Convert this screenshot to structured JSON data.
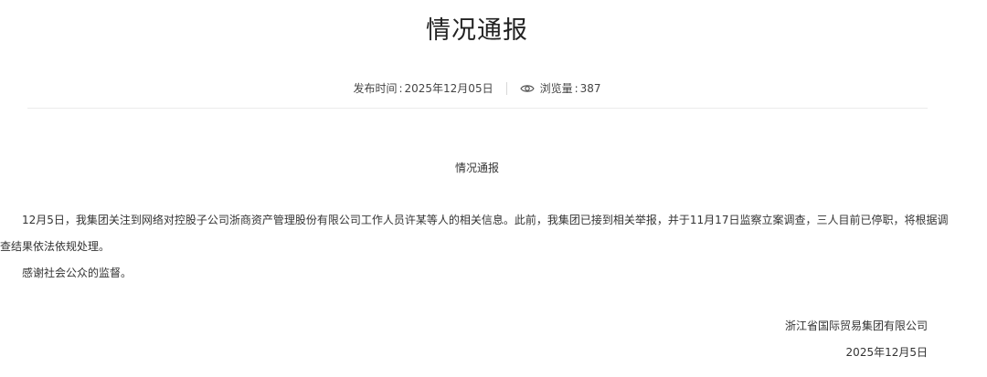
{
  "article": {
    "title": "情况通报",
    "meta": {
      "publish_label": "发布时间",
      "publish_date": "2025年12月05日",
      "views_label": "浏览量",
      "views_count": "387",
      "views_icon": "eye-icon"
    },
    "body_heading": "情况通报",
    "paragraphs": [
      "12月5日，我集团关注到网络对控股子公司浙商资产管理股份有限公司工作人员许某等人的相关信息。此前，我集团已接到相关举报，并于11月17日监察立案调查，三人目前已停职，将根据调查结果依法依规处理。",
      "感谢社会公众的监督。"
    ],
    "signature": {
      "organization": "浙江省国际贸易集团有限公司",
      "date": "2025年12月5日"
    }
  },
  "colors": {
    "text": "#333333",
    "title": "#222222",
    "rule": "#ececec"
  }
}
